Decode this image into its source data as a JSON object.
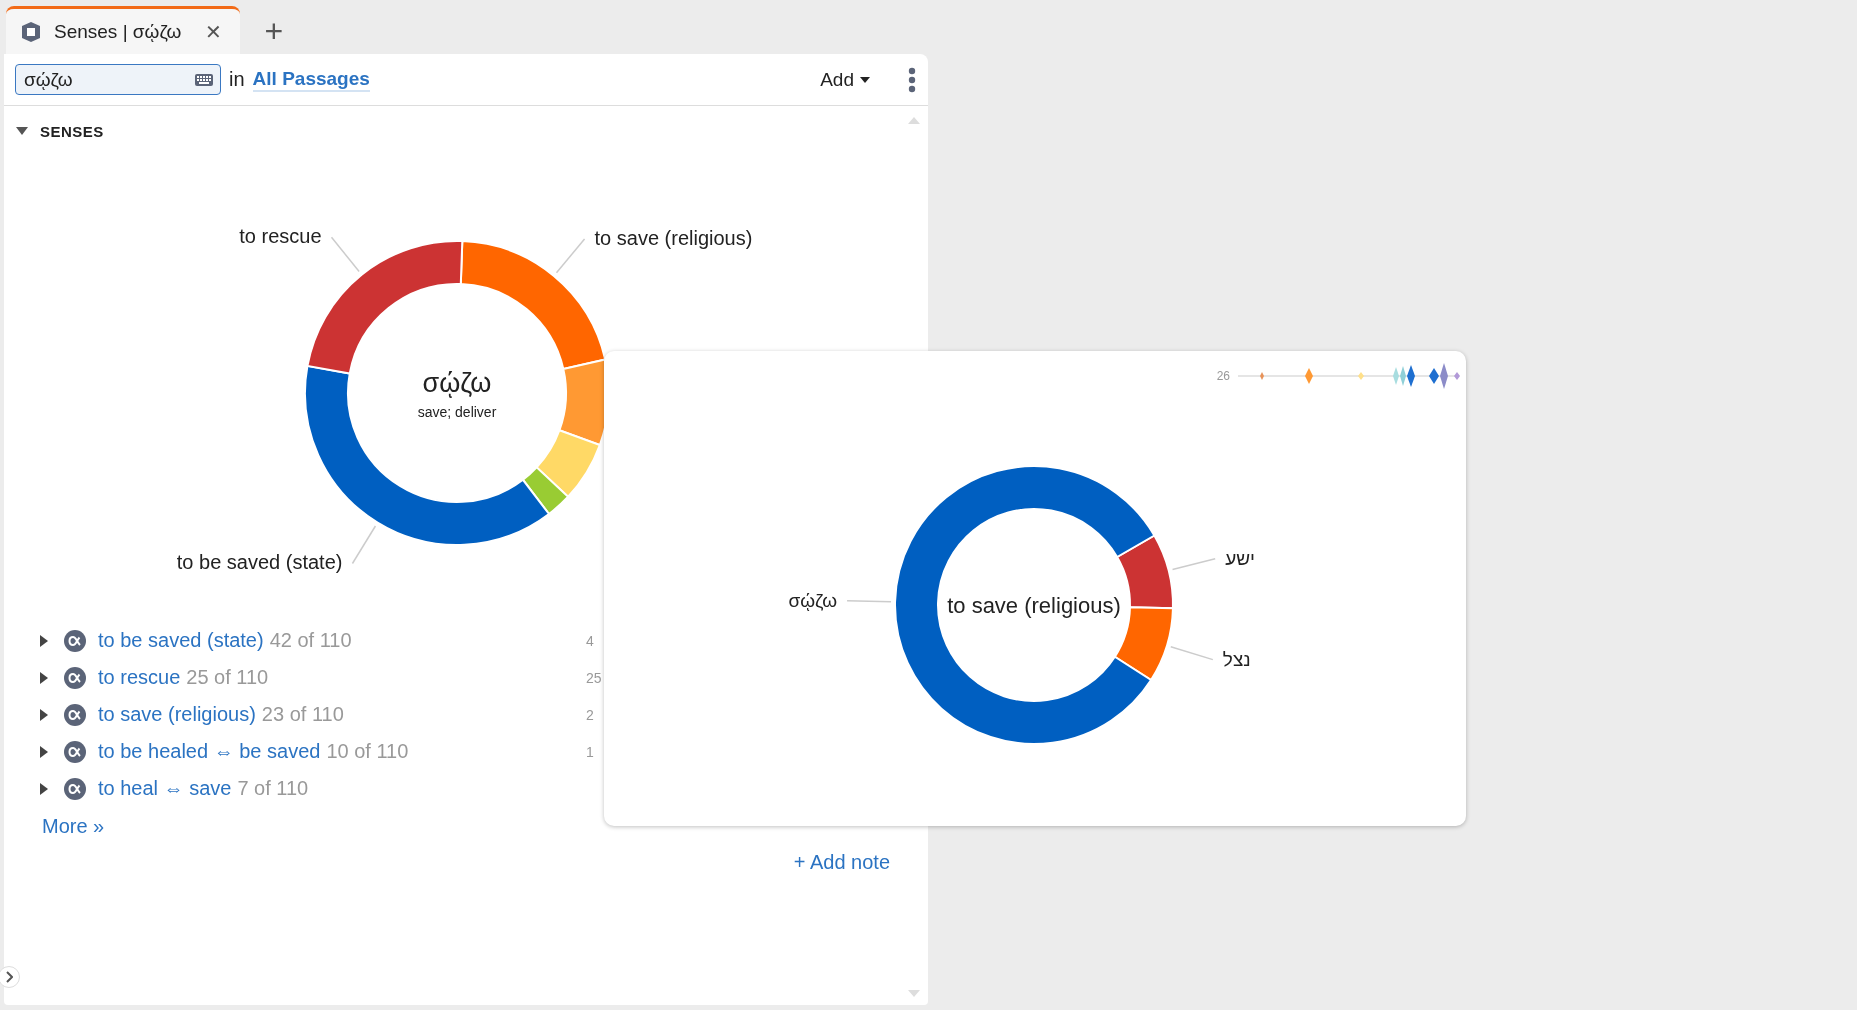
{
  "tab": {
    "title": "Senses | σῴζω",
    "selected": true,
    "close": "✕",
    "new_tab": "+"
  },
  "toolbar": {
    "search_value": "σῴζω",
    "scope_prefix": "in",
    "scope_link": "All Passages",
    "add_button": "Add"
  },
  "section": {
    "title": "SENSES",
    "expanded": true
  },
  "sense_chart": {
    "center_title": "σῴζω",
    "center_subtitle": "save; deliver",
    "chart_data": {
      "type": "donut",
      "categories": [
        "to save (religious)",
        null,
        null,
        null,
        "to be saved (state)",
        "to rescue"
      ],
      "series": [
        {
          "values": [
            20.9,
            9.1,
            6.4,
            2.7,
            38.2,
            22.7
          ]
        }
      ],
      "colors": [
        "#ff6600",
        "#ff9933",
        "#ffd966",
        "#99cc33",
        "#005fc1",
        "#cc3333"
      ]
    }
  },
  "senses": [
    {
      "label": "to be saved (state)",
      "count": "42 of 110",
      "column_2": "4",
      "expanded": false
    },
    {
      "label": "to rescue",
      "count": "25 of 110",
      "column_2": "25",
      "expanded": false
    },
    {
      "label": "to save (religious)",
      "count": "23 of 110",
      "column_2": "2",
      "expanded": false
    },
    {
      "label": "to be healed ⇔ be saved",
      "count": "10 of 110",
      "column_2": "1",
      "expanded": false
    },
    {
      "label": "to heal ⇔ save",
      "count": "7 of 110",
      "expanded": false
    }
  ],
  "more_link": "More »",
  "add_note": "+ Add note",
  "popup": {
    "sparkline_label": "26",
    "center_title": "to save (religious)",
    "chart_data": {
      "type": "donut",
      "categories": [
        "ישע",
        "נצל",
        "σῴζω"
      ],
      "series": [
        {
          "values": [
            8.7,
            8.7,
            82.6
          ]
        }
      ],
      "colors": [
        "#cc3333",
        "#ff6600",
        "#005fc1"
      ]
    }
  }
}
